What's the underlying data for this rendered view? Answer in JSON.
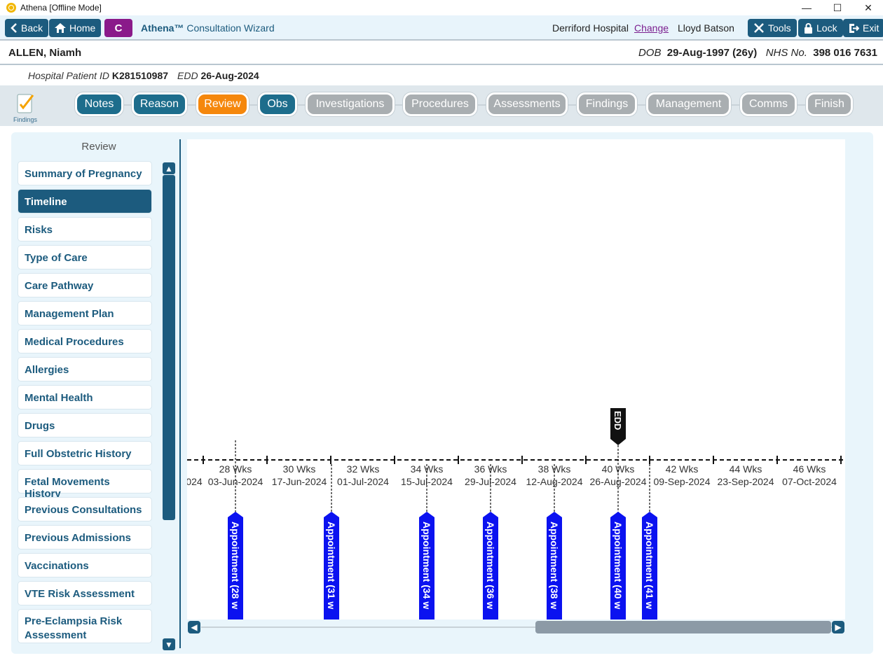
{
  "window": {
    "title": "Athena [Offline Mode]"
  },
  "topbar": {
    "back_label": "Back",
    "home_label": "Home",
    "c_label": "C",
    "product": "Athena™",
    "wizard": "Consultation Wizard",
    "hospital": "Derriford Hospital",
    "change_label": "Change",
    "user": "Lloyd Batson",
    "tools_label": "Tools",
    "lock_label": "Lock",
    "exit_label": "Exit"
  },
  "patient": {
    "name": "ALLEN, Niamh",
    "dob_label": "DOB",
    "dob": "29-Aug-1997 (26y)",
    "nhs_label": "NHS No.",
    "nhs": "398 016 7631",
    "hpid_label": "Hospital Patient ID",
    "hpid": "K281510987",
    "edd_label": "EDD",
    "edd": "26-Aug-2024"
  },
  "steps": {
    "findings_label": "Findings",
    "items": [
      "Notes",
      "Reason",
      "Review",
      "Obs",
      "Investigations",
      "Procedures",
      "Assessments",
      "Findings",
      "Management",
      "Comms",
      "Finish"
    ]
  },
  "review": {
    "title": "Review",
    "items": [
      "Summary of Pregnancy",
      "Timeline",
      "Risks",
      "Type of Care",
      "Care Pathway",
      "Management Plan",
      "Medical Procedures",
      "Allergies",
      "Mental Health",
      "Drugs",
      "Full Obstetric History",
      "Fetal Movements History",
      "Previous Consultations",
      "Previous Admissions",
      "Vaccinations",
      "VTE Risk Assessment",
      "Pre-Eclampsia Risk Assessment"
    ],
    "selected": "Timeline"
  },
  "timeline": {
    "weeks": [
      "28 Wks",
      "30 Wks",
      "32 Wks",
      "34 Wks",
      "36 Wks",
      "38 Wks",
      "40 Wks",
      "42 Wks",
      "44 Wks",
      "46 Wks"
    ],
    "dates": [
      "024",
      "03-Jun-2024",
      "17-Jun-2024",
      "01-Jul-2024",
      "15-Jul-2024",
      "29-Jul-2024",
      "12-Aug-2024",
      "26-Aug-2024",
      "09-Sep-2024",
      "23-Sep-2024",
      "07-Oct-2024"
    ],
    "edd_marker": "EDD",
    "appointments": [
      "Appointment (28 w",
      "Appointment (31 w",
      "Appointment (34 w",
      "Appointment (36 w",
      "Appointment (38 w",
      "Appointment (40 w",
      "Appointment (41 w"
    ]
  }
}
